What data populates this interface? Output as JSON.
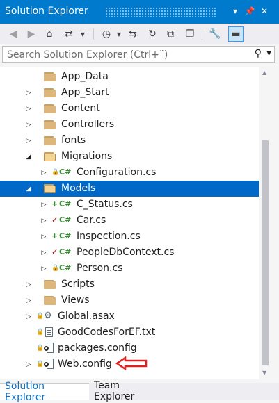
{
  "window": {
    "title": "Solution Explorer",
    "controls": [
      "▾",
      "📌",
      "✕"
    ]
  },
  "toolbar": {
    "buttons": [
      {
        "name": "back-icon",
        "glyph": "◀"
      },
      {
        "name": "forward-icon",
        "glyph": "▶"
      },
      {
        "name": "home-icon",
        "glyph": "⌂"
      },
      {
        "name": "switch-views-icon",
        "glyph": "⇄"
      },
      {
        "name": "pending-changes-filter-icon",
        "glyph": "◷"
      },
      {
        "name": "sync-icon",
        "glyph": "⇆"
      },
      {
        "name": "refresh-icon",
        "glyph": "↻"
      },
      {
        "name": "collapse-all-icon",
        "glyph": "⧉"
      },
      {
        "name": "show-all-files-icon",
        "glyph": "❐"
      },
      {
        "name": "properties-icon",
        "glyph": "🔧"
      },
      {
        "name": "preview-icon",
        "glyph": "▬"
      }
    ]
  },
  "search": {
    "placeholder": "Search Solution Explorer (Ctrl+¨)",
    "icon": "search-icon"
  },
  "tree": {
    "items": [
      {
        "label": "App_Data",
        "type": "folder",
        "expander": "",
        "status": ""
      },
      {
        "label": "App_Start",
        "type": "folder",
        "expander": "collapsed",
        "status": ""
      },
      {
        "label": "Content",
        "type": "folder",
        "expander": "collapsed",
        "status": ""
      },
      {
        "label": "Controllers",
        "type": "folder",
        "expander": "collapsed",
        "status": ""
      },
      {
        "label": "fonts",
        "type": "folder",
        "expander": "collapsed",
        "status": ""
      },
      {
        "label": "Migrations",
        "type": "folder-open",
        "expander": "expanded",
        "status": ""
      },
      {
        "label": "Configuration.cs",
        "type": "cs",
        "expander": "collapsed",
        "status": "lock"
      },
      {
        "label": "Models",
        "type": "folder-open",
        "expander": "expanded",
        "status": "",
        "selected": true
      },
      {
        "label": "C_Status.cs",
        "type": "cs",
        "expander": "collapsed",
        "status": "plus"
      },
      {
        "label": "Car.cs",
        "type": "cs",
        "expander": "collapsed",
        "status": "check"
      },
      {
        "label": "Inspection.cs",
        "type": "cs",
        "expander": "collapsed",
        "status": "plus"
      },
      {
        "label": "PeopleDbContext.cs",
        "type": "cs",
        "expander": "collapsed",
        "status": "check"
      },
      {
        "label": "Person.cs",
        "type": "cs",
        "expander": "collapsed",
        "status": "lock"
      },
      {
        "label": "Scripts",
        "type": "folder",
        "expander": "collapsed",
        "status": ""
      },
      {
        "label": "Views",
        "type": "folder",
        "expander": "collapsed",
        "status": ""
      },
      {
        "label": "Global.asax",
        "type": "asax",
        "expander": "collapsed",
        "status": "lock"
      },
      {
        "label": "GoodCodesForEF.txt",
        "type": "txt",
        "expander": "",
        "status": "lock"
      },
      {
        "label": "packages.config",
        "type": "config",
        "expander": "",
        "status": "lock"
      },
      {
        "label": "Web.config",
        "type": "config",
        "expander": "collapsed",
        "status": "lock"
      }
    ]
  },
  "annotation": {
    "color": "#e02020"
  },
  "tabs": [
    {
      "label": "Solution Explorer",
      "active": true
    },
    {
      "label": "Team Explorer",
      "active": false
    }
  ],
  "colors": {
    "accent": "#007acc",
    "selection": "#0069c8",
    "cs_green": "#388a34"
  }
}
